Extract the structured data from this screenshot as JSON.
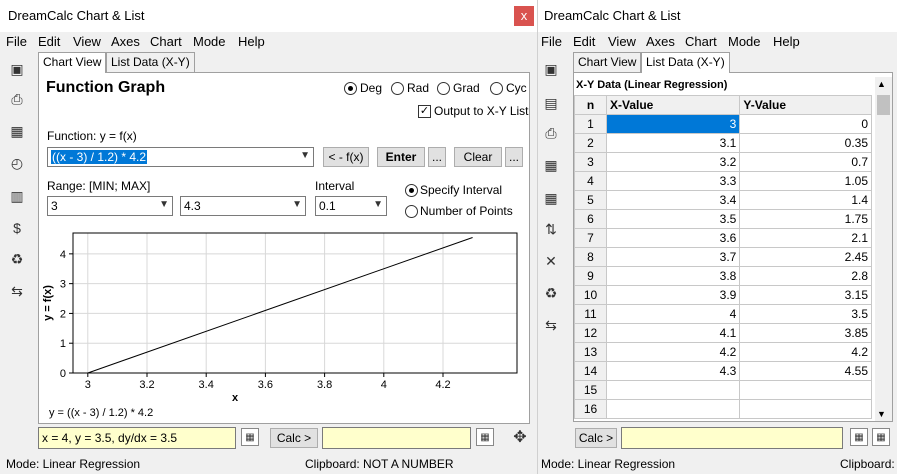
{
  "left_window": {
    "title": "DreamCalc Chart & List",
    "close_glyph": "x",
    "menu": [
      "File",
      "Edit",
      "View",
      "Axes",
      "Chart",
      "Mode",
      "Help"
    ],
    "tabs": [
      "Chart View",
      "List Data (X-Y)"
    ],
    "heading": "Function Graph",
    "angle_modes": [
      "Deg",
      "Rad",
      "Grad",
      "Cyc"
    ],
    "selected_angle_mode": "Deg",
    "output_checkbox_label": "Output to X-Y List",
    "output_checked": true,
    "function_label": "Function: y = f(x)",
    "function_value": "((x - 3) / 1.2) * 4.2",
    "fx_button": "< - f(x)",
    "enter_button": "Enter",
    "more_button": "...",
    "clear_button": "Clear",
    "more_button2": "...",
    "range_label": "Range: [MIN; MAX]",
    "range_min": "3",
    "range_max": "4.3",
    "interval_label": "Interval",
    "interval_value": "0.1",
    "specify_interval_label": "Specify Interval",
    "number_of_points_label": "Number of Points",
    "readout": "x = 4, y = 3.5, dy/dx = 3.5",
    "calc_button": "Calc >",
    "status_mode": "Mode: Linear Regression",
    "status_clipboard": "Clipboard: NOT A NUMBER"
  },
  "chart_data": {
    "type": "line",
    "caption": "y = ((x - 3) / 1.2) * 4.2",
    "xlabel": "x",
    "ylabel": "y = f(x)",
    "xlim": [
      2.95,
      4.45
    ],
    "ylim": [
      0,
      4.7
    ],
    "x_ticks": [
      "3",
      "3.2",
      "3.4",
      "3.6",
      "3.8",
      "4",
      "4.2"
    ],
    "y_ticks": [
      "0",
      "1",
      "2",
      "3",
      "4"
    ],
    "grid": true,
    "series": [
      {
        "x": [
          3,
          4.3
        ],
        "y": [
          0,
          4.55
        ]
      }
    ]
  },
  "right_window": {
    "title": "DreamCalc Chart & List",
    "menu": [
      "File",
      "Edit",
      "View",
      "Axes",
      "Chart",
      "Mode",
      "Help"
    ],
    "tabs": [
      "Chart View",
      "List Data (X-Y)"
    ],
    "table_title": "X-Y Data (Linear Regression)",
    "columns": [
      "n",
      "X-Value",
      "Y-Value"
    ],
    "rows": [
      [
        "1",
        "3",
        "0"
      ],
      [
        "2",
        "3.1",
        "0.35"
      ],
      [
        "3",
        "3.2",
        "0.7"
      ],
      [
        "4",
        "3.3",
        "1.05"
      ],
      [
        "5",
        "3.4",
        "1.4"
      ],
      [
        "6",
        "3.5",
        "1.75"
      ],
      [
        "7",
        "3.6",
        "2.1"
      ],
      [
        "8",
        "3.7",
        "2.45"
      ],
      [
        "9",
        "3.8",
        "2.8"
      ],
      [
        "10",
        "3.9",
        "3.15"
      ],
      [
        "11",
        "4",
        "3.5"
      ],
      [
        "12",
        "4.1",
        "3.85"
      ],
      [
        "13",
        "4.2",
        "4.2"
      ],
      [
        "14",
        "4.3",
        "4.55"
      ],
      [
        "15",
        "",
        ""
      ],
      [
        "16",
        "",
        ""
      ]
    ],
    "calc_button": "Calc >",
    "status_mode": "Mode: Linear Regression",
    "status_clipboard": "Clipboard:"
  },
  "icons": {
    "save": "save-icon",
    "print": "print-icon",
    "calc": "calculator-icon",
    "graph": "graph-icon",
    "chart": "bar-chart-icon",
    "money": "money-icon",
    "clear": "bucket-icon",
    "swap": "swap-icon",
    "move": "move-icon"
  },
  "colors": {
    "selection": "#0078d7",
    "close": "#d9534f",
    "readout_bg": "#ffffcc"
  }
}
